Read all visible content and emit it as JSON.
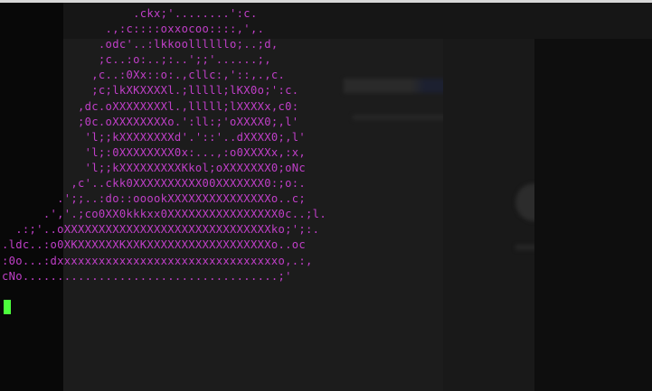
{
  "terminal": {
    "ascii_art": "                   .ckx;'........':c.\n               .,:c::::oxxocoo::::,',.\n              .odc'..:lkkoollllllo;..;d,\n              ;c..:o:..;:..';;'......;,\n             ,c..:0Xx::o:.,cllc:,'::,.,c.\n             ;c;lkXKXXXXl.;lllll;lKX0o;':c.\n           ,dc.oXXXXXXXXl.,lllll;lXXXXx,c0:\n           ;0c.oXXXXXXXXo.':ll:;'oXXXX0;,l'\n            'l;;kXXXXXXXXd'.'::'..dXXXX0;,l'\n            'l;:0XXXXXXXX0x:...,:o0XXXXx,:x,\n            'l;;kXXXXXXXXXKkol;oXXXXXXX0;oNc\n          ,c'..ckk0XXXXXXXXXX00XXXXXXX0:;o:.\n        .';;..:do::ooookXXXXXXXXXXXXXXXo..c;\n      .','.;co0XX0kkkxx0XXXXXXXXXXXXXXXX0c..;l.\n  .:;'..oXXXXXXXXXXXXXXXXXXXXXXXXXXXXXXko;';:.\n.ldc..:o0XKXXXXXXKXXKXXXXXXXXXXXXXXXXXXo..oc\n:0o...:dxxxxxxxxxxxxxxxxxxxxxxxxxxxxxxxxo,.:,\ncNo.....................................;'",
    "text_color": "#c03fc8",
    "cursor_color": "#4cff3c"
  }
}
